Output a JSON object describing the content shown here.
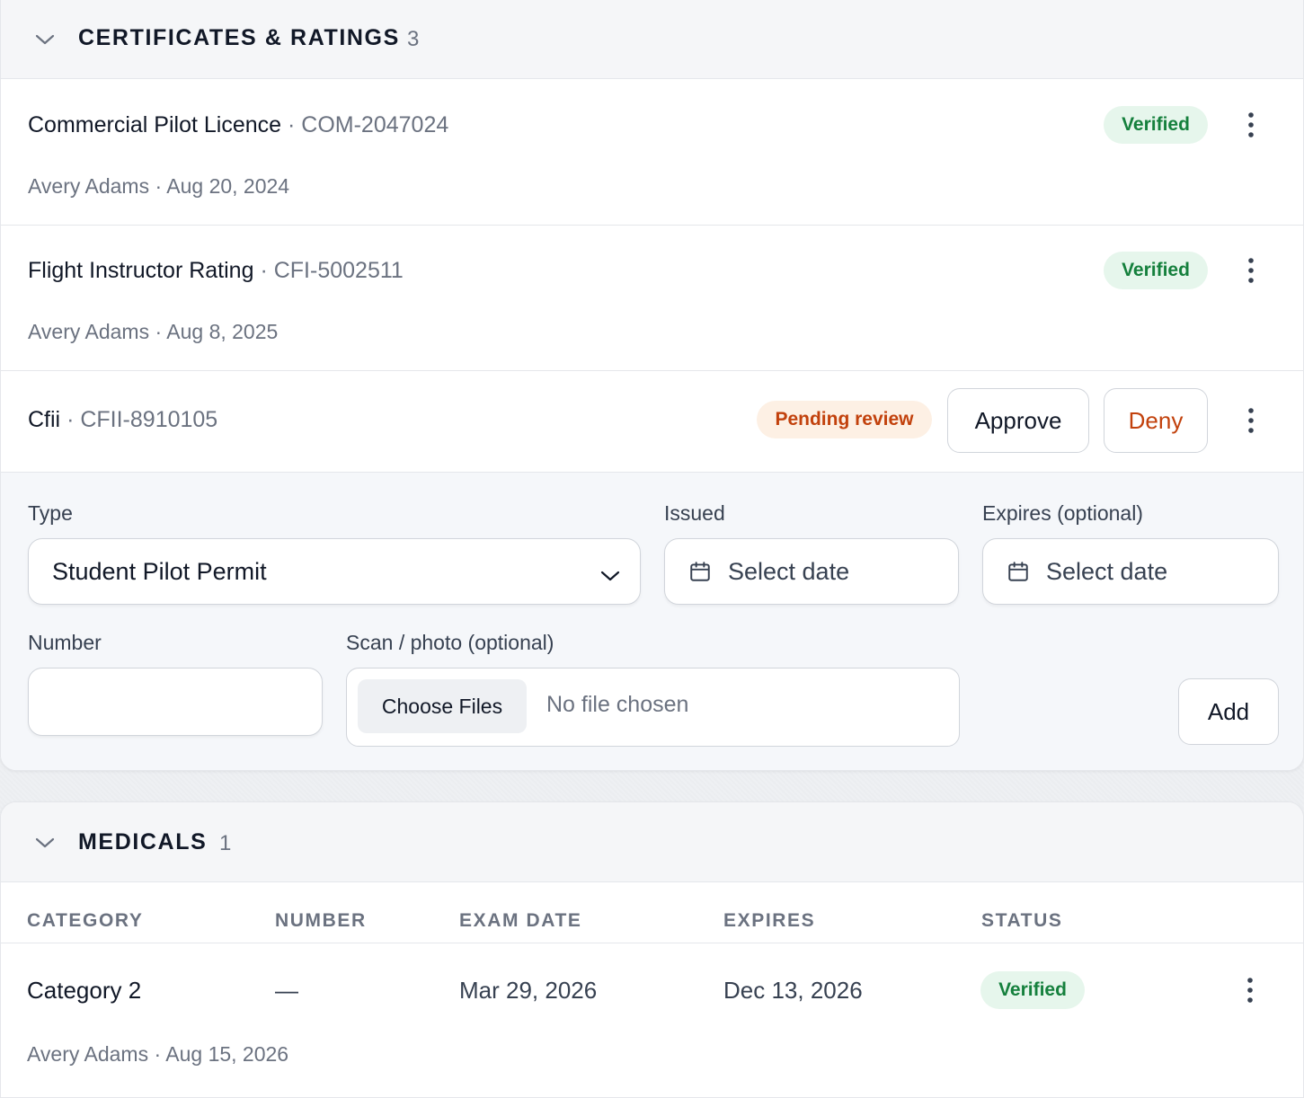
{
  "certificates": {
    "title": "CERTIFICATES & RATINGS",
    "count": "3",
    "items": [
      {
        "name": "Commercial Pilot Licence",
        "separator": "·",
        "number": "COM-2047024",
        "meta": "Avery Adams · Aug 20, 2024",
        "status": "Verified"
      },
      {
        "name": "Flight Instructor Rating",
        "separator": "·",
        "number": "CFI-5002511",
        "meta": "Avery Adams · Aug 8, 2025",
        "status": "Verified"
      },
      {
        "name": "Cfii",
        "separator": "·",
        "number": "CFII-8910105",
        "status": "Pending review",
        "approve_label": "Approve",
        "deny_label": "Deny"
      }
    ],
    "form": {
      "type_label": "Type",
      "type_value": "Student Pilot Permit",
      "issued_label": "Issued",
      "issued_placeholder": "Select date",
      "expires_label": "Expires (optional)",
      "expires_placeholder": "Select date",
      "number_label": "Number",
      "number_value": "",
      "scan_label": "Scan / photo (optional)",
      "choose_files_label": "Choose Files",
      "no_file_text": "No file chosen",
      "add_label": "Add"
    }
  },
  "medicals": {
    "title": "MEDICALS",
    "count": "1",
    "columns": [
      "CATEGORY",
      "NUMBER",
      "EXAM DATE",
      "EXPIRES",
      "STATUS"
    ],
    "rows": [
      {
        "category": "Category 2",
        "number": "—",
        "exam_date": "Mar 29, 2026",
        "expires": "Dec 13, 2026",
        "status": "Verified",
        "meta": "Avery Adams · Aug 15, 2026"
      }
    ]
  },
  "colors": {
    "verified_bg": "#e6f6ec",
    "verified_text": "#15803d",
    "pending_bg": "#fdf0e4",
    "pending_text": "#c2410c",
    "deny_text": "#c2410c"
  },
  "icons": {
    "collapse": "chevron-down-icon",
    "menu": "more-vertical-icon",
    "calendar": "calendar-icon",
    "select": "chevron-down-icon"
  }
}
